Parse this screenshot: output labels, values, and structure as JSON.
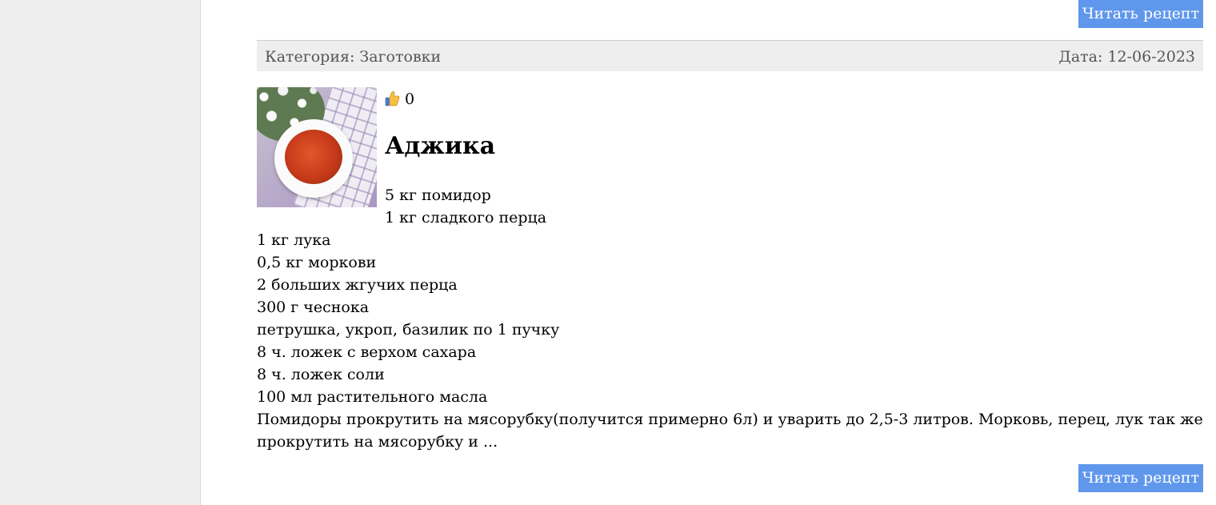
{
  "read_more_label": "Читать рецепт",
  "recipe": {
    "category": "Категория: Заготовки",
    "date": "Дата: 12-06-2023",
    "likes": "0",
    "title": "Аджика",
    "ingredients": [
      "5 кг помидор",
      "1 кг сладкого перца",
      "1 кг лука",
      "0,5 кг моркови",
      "2 больших жгучих перца",
      "300 г чеснока",
      "петрушка, укроп, базилик по 1 пучку",
      "8 ч. ложек с верхом сахара",
      "8 ч. ложек соли",
      "100 мл растительного масла"
    ],
    "description": "Помидоры прокрутить на мясорубку(получится примерно 6л) и уварить до 2,5-3 литров. Морковь, перец, лук так же прокрутить на мясорубку и ..."
  },
  "colors": {
    "sidebar": "#eeeeee",
    "button": "#5f97ec",
    "meta_bar": "#eeeeee"
  },
  "icons": {
    "like": "thumbs-up-icon"
  }
}
